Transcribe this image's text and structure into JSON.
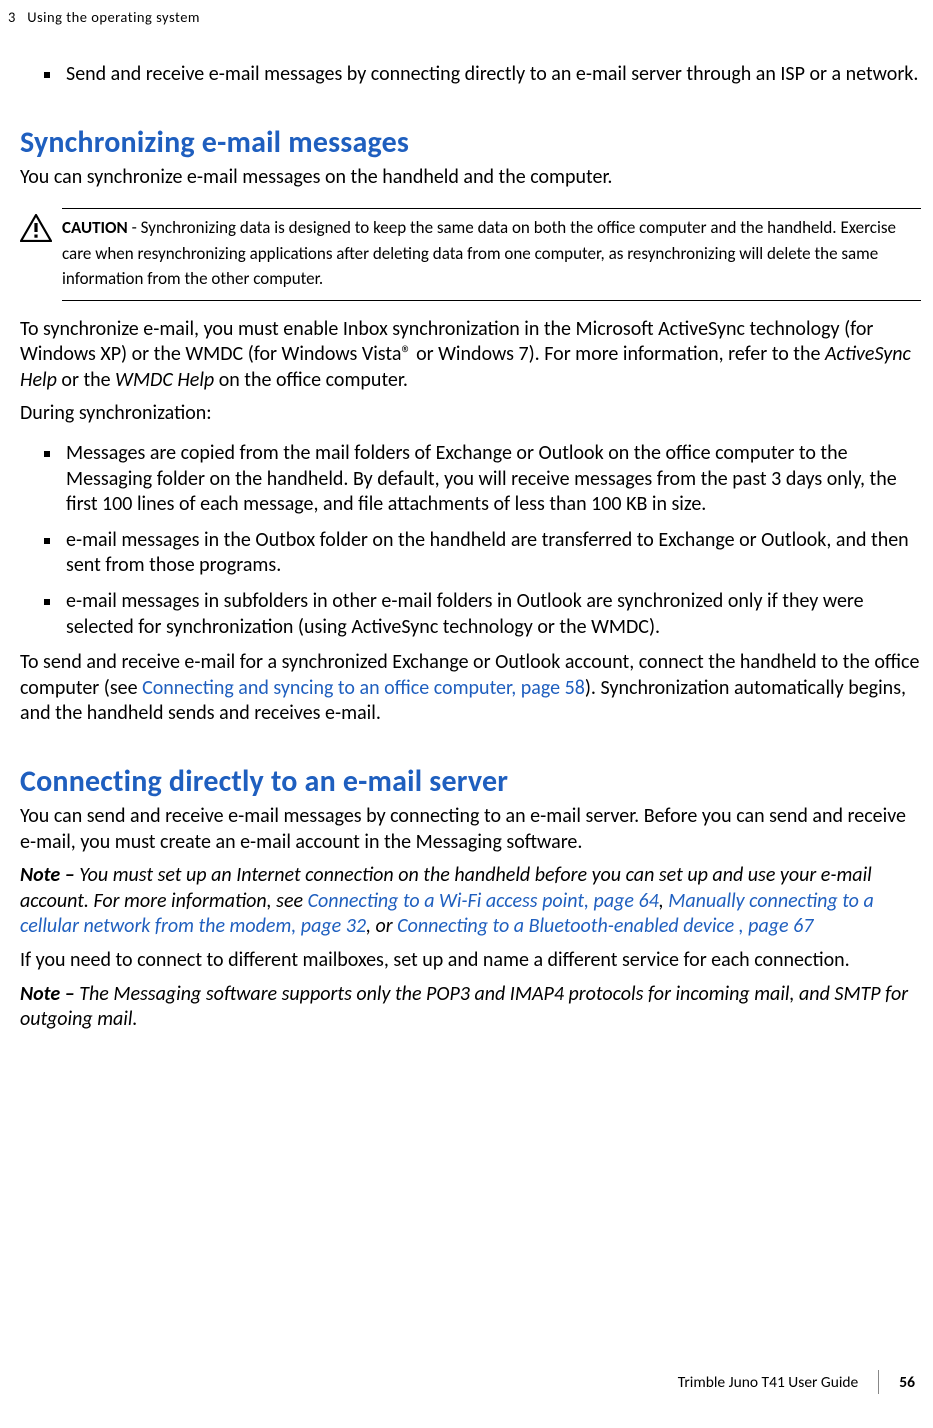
{
  "header": {
    "chapter_num": "3",
    "chapter_title": "Using the  operating system"
  },
  "intro_bullet": "Send and receive e-mail messages by connecting directly to an e-mail server through an ISP or a network.",
  "section_sync": {
    "heading": "Synchronizing e-mail messages",
    "intro": "You can synchronize e-mail messages on the handheld and the computer.",
    "caution_label": "CAUTION",
    "caution_sep": " - ",
    "caution_body": "Synchronizing data is designed to keep the same data on both the office computer and the handheld. Exercise care when resynchronizing applications after deleting data from one computer, as resynchronizing will delete the same information from the other computer.",
    "para2_pre": "To synchronize e-mail, you must enable Inbox synchronization in the Microsoft ActiveSync technology (for Windows XP) or the WMDC (for Windows Vista® or Windows 7). For more information, refer to the ",
    "para2_em1": "ActiveSync Help",
    "para2_mid": " or the ",
    "para2_em2": "WMDC Help",
    "para2_post": " on the office computer.",
    "during": "During synchronization:",
    "bullets": [
      "Messages are copied from the mail folders of Exchange or Outlook on the office computer to the Messaging folder on the handheld. By default, you will receive messages from the past 3 days only, the first 100 lines of each message, and file attachments of less than 100 KB in size.",
      "e-mail messages in the Outbox folder on the handheld are transferred to Exchange or Outlook, and then sent from those programs.",
      "e-mail messages in subfolders in other e-mail folders in Outlook are synchronized only if they were selected for synchronization (using ActiveSync technology or the WMDC)."
    ],
    "para3_pre": "To send and receive e-mail for a synchronized Exchange or Outlook account, connect the handheld to the office computer (see ",
    "para3_link": "Connecting and syncing to an office computer, page 58",
    "para3_post": "). Synchronization automatically begins, and the handheld sends and receives e-mail."
  },
  "section_conn": {
    "heading": "Connecting directly to an e-mail server",
    "intro": "You can send and receive e-mail messages by connecting to an e-mail server. Before you can send and receive e-mail, you must create an e-mail account in the Messaging software.",
    "note1_label": "Note  –",
    "note1_pre": " You must set up an Internet connection on the handheld before you can set up and use your e-mail account. For more information, see ",
    "note1_link1": "Connecting to a Wi-Fi access point, page 64",
    "note1_mid1": ", ",
    "note1_link2": "Manually connecting to a cellular network from the modem, page 32",
    "note1_mid2": ", or ",
    "note1_link3": "Connecting to a Bluetooth-enabled device , page 67",
    "para2": "If you need to connect to different mailboxes, set up and name a different service for each connection.",
    "note2_label": "Note  –",
    "note2_body": " The Messaging software supports only the POP3 and IMAP4 protocols for incoming mail, and SMTP for outgoing mail."
  },
  "footer": {
    "guide": "Trimble Juno T41 User Guide",
    "page": "56"
  }
}
